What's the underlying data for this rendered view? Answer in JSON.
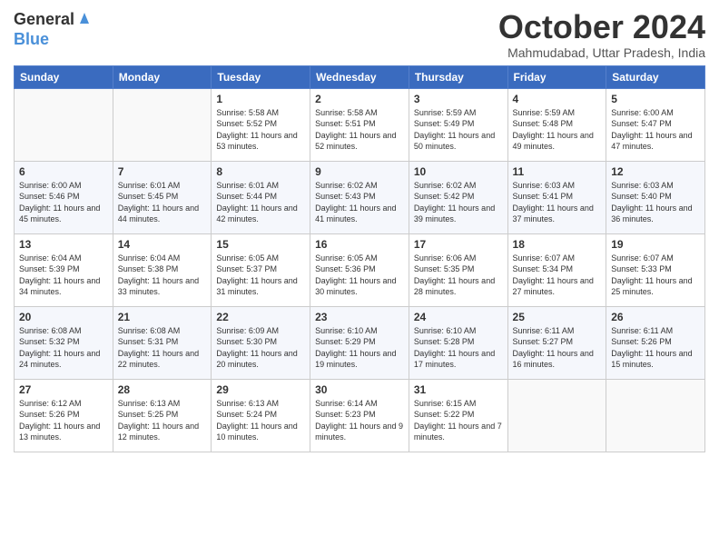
{
  "header": {
    "logo_general": "General",
    "logo_blue": "Blue",
    "month_title": "October 2024",
    "subtitle": "Mahmudabad, Uttar Pradesh, India"
  },
  "days_of_week": [
    "Sunday",
    "Monday",
    "Tuesday",
    "Wednesday",
    "Thursday",
    "Friday",
    "Saturday"
  ],
  "weeks": [
    [
      {
        "day": "",
        "info": ""
      },
      {
        "day": "",
        "info": ""
      },
      {
        "day": "1",
        "info": "Sunrise: 5:58 AM\nSunset: 5:52 PM\nDaylight: 11 hours and 53 minutes."
      },
      {
        "day": "2",
        "info": "Sunrise: 5:58 AM\nSunset: 5:51 PM\nDaylight: 11 hours and 52 minutes."
      },
      {
        "day": "3",
        "info": "Sunrise: 5:59 AM\nSunset: 5:49 PM\nDaylight: 11 hours and 50 minutes."
      },
      {
        "day": "4",
        "info": "Sunrise: 5:59 AM\nSunset: 5:48 PM\nDaylight: 11 hours and 49 minutes."
      },
      {
        "day": "5",
        "info": "Sunrise: 6:00 AM\nSunset: 5:47 PM\nDaylight: 11 hours and 47 minutes."
      }
    ],
    [
      {
        "day": "6",
        "info": "Sunrise: 6:00 AM\nSunset: 5:46 PM\nDaylight: 11 hours and 45 minutes."
      },
      {
        "day": "7",
        "info": "Sunrise: 6:01 AM\nSunset: 5:45 PM\nDaylight: 11 hours and 44 minutes."
      },
      {
        "day": "8",
        "info": "Sunrise: 6:01 AM\nSunset: 5:44 PM\nDaylight: 11 hours and 42 minutes."
      },
      {
        "day": "9",
        "info": "Sunrise: 6:02 AM\nSunset: 5:43 PM\nDaylight: 11 hours and 41 minutes."
      },
      {
        "day": "10",
        "info": "Sunrise: 6:02 AM\nSunset: 5:42 PM\nDaylight: 11 hours and 39 minutes."
      },
      {
        "day": "11",
        "info": "Sunrise: 6:03 AM\nSunset: 5:41 PM\nDaylight: 11 hours and 37 minutes."
      },
      {
        "day": "12",
        "info": "Sunrise: 6:03 AM\nSunset: 5:40 PM\nDaylight: 11 hours and 36 minutes."
      }
    ],
    [
      {
        "day": "13",
        "info": "Sunrise: 6:04 AM\nSunset: 5:39 PM\nDaylight: 11 hours and 34 minutes."
      },
      {
        "day": "14",
        "info": "Sunrise: 6:04 AM\nSunset: 5:38 PM\nDaylight: 11 hours and 33 minutes."
      },
      {
        "day": "15",
        "info": "Sunrise: 6:05 AM\nSunset: 5:37 PM\nDaylight: 11 hours and 31 minutes."
      },
      {
        "day": "16",
        "info": "Sunrise: 6:05 AM\nSunset: 5:36 PM\nDaylight: 11 hours and 30 minutes."
      },
      {
        "day": "17",
        "info": "Sunrise: 6:06 AM\nSunset: 5:35 PM\nDaylight: 11 hours and 28 minutes."
      },
      {
        "day": "18",
        "info": "Sunrise: 6:07 AM\nSunset: 5:34 PM\nDaylight: 11 hours and 27 minutes."
      },
      {
        "day": "19",
        "info": "Sunrise: 6:07 AM\nSunset: 5:33 PM\nDaylight: 11 hours and 25 minutes."
      }
    ],
    [
      {
        "day": "20",
        "info": "Sunrise: 6:08 AM\nSunset: 5:32 PM\nDaylight: 11 hours and 24 minutes."
      },
      {
        "day": "21",
        "info": "Sunrise: 6:08 AM\nSunset: 5:31 PM\nDaylight: 11 hours and 22 minutes."
      },
      {
        "day": "22",
        "info": "Sunrise: 6:09 AM\nSunset: 5:30 PM\nDaylight: 11 hours and 20 minutes."
      },
      {
        "day": "23",
        "info": "Sunrise: 6:10 AM\nSunset: 5:29 PM\nDaylight: 11 hours and 19 minutes."
      },
      {
        "day": "24",
        "info": "Sunrise: 6:10 AM\nSunset: 5:28 PM\nDaylight: 11 hours and 17 minutes."
      },
      {
        "day": "25",
        "info": "Sunrise: 6:11 AM\nSunset: 5:27 PM\nDaylight: 11 hours and 16 minutes."
      },
      {
        "day": "26",
        "info": "Sunrise: 6:11 AM\nSunset: 5:26 PM\nDaylight: 11 hours and 15 minutes."
      }
    ],
    [
      {
        "day": "27",
        "info": "Sunrise: 6:12 AM\nSunset: 5:26 PM\nDaylight: 11 hours and 13 minutes."
      },
      {
        "day": "28",
        "info": "Sunrise: 6:13 AM\nSunset: 5:25 PM\nDaylight: 11 hours and 12 minutes."
      },
      {
        "day": "29",
        "info": "Sunrise: 6:13 AM\nSunset: 5:24 PM\nDaylight: 11 hours and 10 minutes."
      },
      {
        "day": "30",
        "info": "Sunrise: 6:14 AM\nSunset: 5:23 PM\nDaylight: 11 hours and 9 minutes."
      },
      {
        "day": "31",
        "info": "Sunrise: 6:15 AM\nSunset: 5:22 PM\nDaylight: 11 hours and 7 minutes."
      },
      {
        "day": "",
        "info": ""
      },
      {
        "day": "",
        "info": ""
      }
    ]
  ]
}
